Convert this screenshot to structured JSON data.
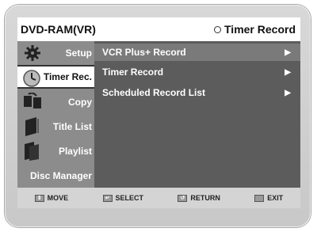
{
  "header": {
    "title": "DVD-RAM(VR)",
    "context": "Timer Record"
  },
  "sidebar": {
    "items": [
      {
        "label": "Setup",
        "icon": "gear-icon",
        "selected": false
      },
      {
        "label": "Timer Rec.",
        "icon": "clock-icon",
        "selected": true
      },
      {
        "label": "Copy",
        "icon": "copy-icon",
        "selected": false
      },
      {
        "label": "Title List",
        "icon": "title-list-icon",
        "selected": false
      },
      {
        "label": "Playlist",
        "icon": "playlist-icon",
        "selected": false
      },
      {
        "label": "Disc Manager",
        "icon": "disc-icon",
        "selected": false
      }
    ]
  },
  "menu": {
    "items": [
      {
        "label": "VCR Plus+ Record",
        "arrow": "▶",
        "selected": true
      },
      {
        "label": "Timer Record",
        "arrow": "▶",
        "selected": false
      },
      {
        "label": "Scheduled Record List",
        "arrow": "▶",
        "selected": false
      }
    ]
  },
  "footer": {
    "move": "MOVE",
    "select": "SELECT",
    "return": "RETURN",
    "exit": "EXIT"
  }
}
